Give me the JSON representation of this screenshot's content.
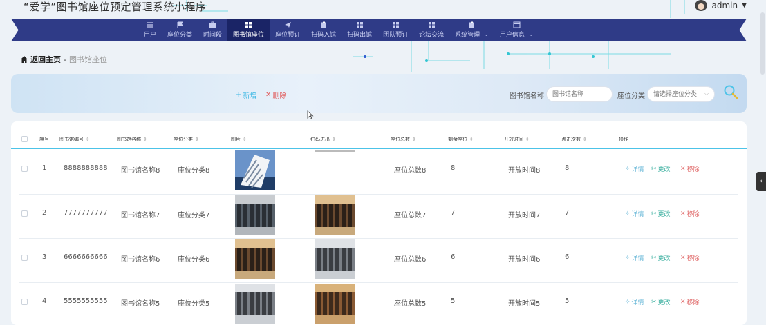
{
  "app": {
    "title": "“爱学”图书馆座位预定管理系统小程序",
    "user": "admin"
  },
  "nav": {
    "items": [
      {
        "label": "用户",
        "icon": "list-icon"
      },
      {
        "label": "座位分类",
        "icon": "flag-icon"
      },
      {
        "label": "时间段",
        "icon": "briefcase-icon"
      },
      {
        "label": "图书馆座位",
        "icon": "grid-icon",
        "active": true
      },
      {
        "label": "座位预订",
        "icon": "send-icon"
      },
      {
        "label": "扫码入馆",
        "icon": "clipboard-icon"
      },
      {
        "label": "扫码出馆",
        "icon": "grid-icon"
      },
      {
        "label": "团队预订",
        "icon": "grid-icon"
      },
      {
        "label": "论坛交流",
        "icon": "grid-icon"
      },
      {
        "label": "系统管理",
        "icon": "clipboard-icon",
        "dropdown": true
      },
      {
        "label": "用户信息",
        "icon": "window-icon",
        "dropdown": true
      }
    ]
  },
  "breadcrumb": {
    "home": "返回主页",
    "sep": "-",
    "current": "图书馆座位"
  },
  "toolbar": {
    "add_label": "新增",
    "delete_label": "删除"
  },
  "filters": {
    "name_label": "图书馆名称",
    "name_placeholder": "图书馆名称",
    "category_label": "座位分类",
    "category_placeholder": "请选择座位分类"
  },
  "table": {
    "headers": [
      "序号",
      "图书馆编号",
      "图书馆名称",
      "座位分类",
      "图片",
      "扫码进出",
      "座位总数",
      "剩余座位",
      "开放时间",
      "点击次数",
      "操作"
    ],
    "actions": {
      "detail": "详情",
      "edit": "更改",
      "remove": "移除"
    },
    "rows": [
      {
        "index": "1",
        "code": "8888888888",
        "name": "图书馆名称8",
        "category": "座位分类8",
        "total": "座位总数8",
        "remaining": "8",
        "open_time": "开放时间8",
        "clicks": "8"
      },
      {
        "index": "2",
        "code": "7777777777",
        "name": "图书馆名称7",
        "category": "座位分类7",
        "total": "座位总数7",
        "remaining": "7",
        "open_time": "开放时间7",
        "clicks": "7"
      },
      {
        "index": "3",
        "code": "6666666666",
        "name": "图书馆名称6",
        "category": "座位分类6",
        "total": "座位总数6",
        "remaining": "6",
        "open_time": "开放时间6",
        "clicks": "6"
      },
      {
        "index": "4",
        "code": "5555555555",
        "name": "图书馆名称5",
        "category": "座位分类5",
        "total": "座位总数5",
        "remaining": "5",
        "open_time": "开放时间5",
        "clicks": "5"
      }
    ]
  },
  "colors": {
    "nav_bg": "#2f3b87",
    "nav_active": "#1a2466",
    "accent": "#4cc3e8",
    "danger": "#e05a5a"
  }
}
